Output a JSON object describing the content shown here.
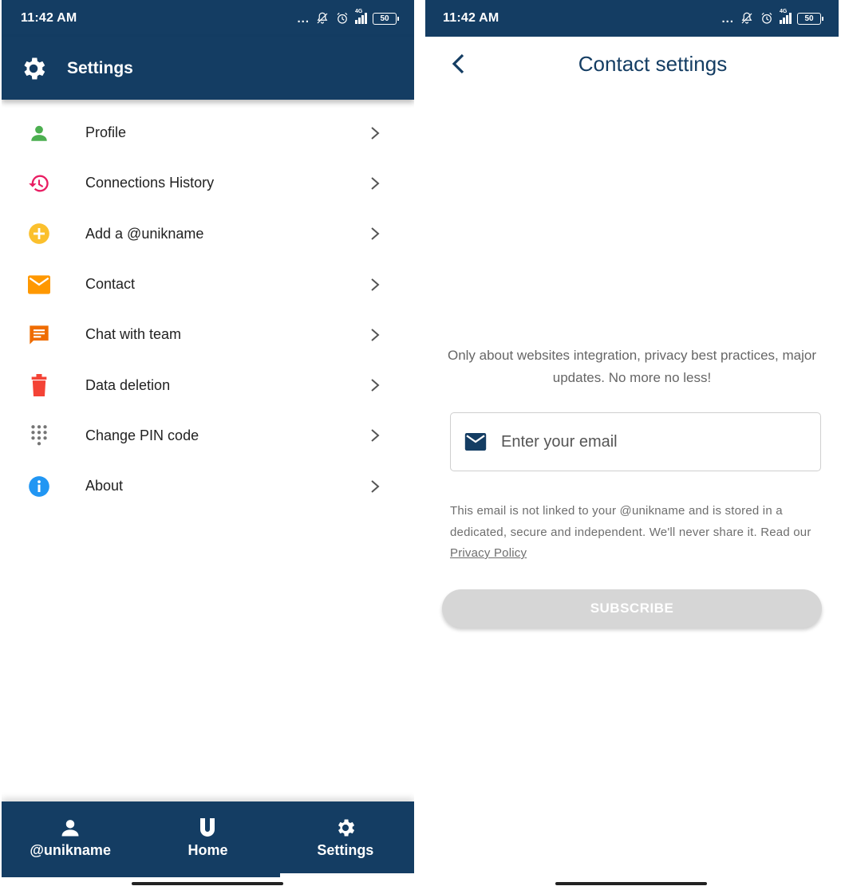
{
  "colors": {
    "primary": "#143d63",
    "profile": "#4caf50",
    "history": "#e91e63",
    "add": "#fbc02d",
    "contact": "#ff9800",
    "chat": "#ef6c00",
    "delete": "#f44336",
    "pin": "#757575",
    "about": "#2196f3",
    "button_disabled": "#d6d6d6"
  },
  "status_bar": {
    "time": "11:42 AM",
    "dots": "...",
    "network": "4G",
    "battery": "50"
  },
  "settings_screen": {
    "title": "Settings",
    "items": [
      {
        "label": "Profile",
        "icon": "person-icon"
      },
      {
        "label": "Connections History",
        "icon": "history-icon"
      },
      {
        "label": "Add a @unikname",
        "icon": "add-circle-icon"
      },
      {
        "label": "Contact",
        "icon": "mail-icon"
      },
      {
        "label": "Chat with team",
        "icon": "chat-icon"
      },
      {
        "label": "Data deletion",
        "icon": "trash-icon"
      },
      {
        "label": "Change PIN code",
        "icon": "dialpad-icon"
      },
      {
        "label": "About",
        "icon": "info-icon"
      }
    ],
    "bottom_nav": [
      {
        "label": "@unikname",
        "icon": "person-icon"
      },
      {
        "label": "Home",
        "icon": "unikname-logo-icon"
      },
      {
        "label": "Settings",
        "icon": "gear-icon"
      }
    ]
  },
  "contact_screen": {
    "title": "Contact settings",
    "description": "Only about websites integration, privacy best practices, major updates. No more no less!",
    "email_placeholder": "Enter your email",
    "disclaimer": "This email is not linked to your @unikname and is stored in a dedicated, secure and independent. We'll never share it. Read our ",
    "privacy_link": "Privacy Policy",
    "subscribe_label": "SUBSCRIBE"
  }
}
